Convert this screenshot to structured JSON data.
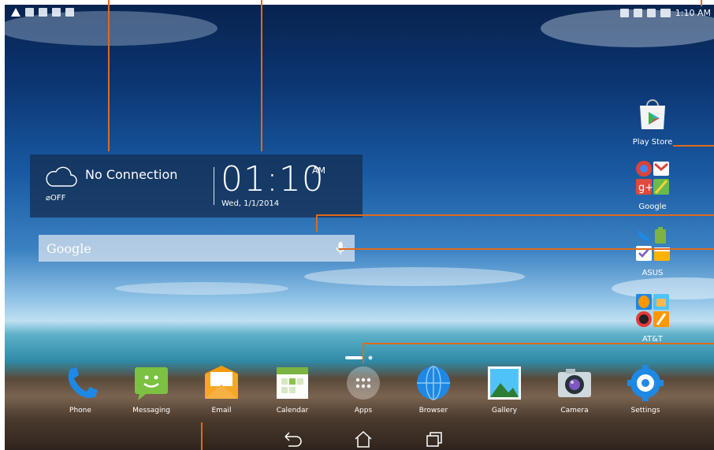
{
  "status_bar": {
    "time": "1:10 AM",
    "left_icons": [
      "alert-icon",
      "notification-icon",
      "email-icon",
      "sim-icon",
      "sd-card-icon"
    ],
    "right_icons": [
      "vibrate-icon",
      "no-signal-icon",
      "no-sim-icon",
      "battery-icon"
    ]
  },
  "weather_clock_widget": {
    "weather_status": "No Connection",
    "weather_toggle": "OFF",
    "time": "01:10",
    "ampm": "AM",
    "date": "Wed, 1/1/2014"
  },
  "search_bar": {
    "label": "Google"
  },
  "side_apps": [
    {
      "label": "Play Store",
      "icon": "play-store-icon"
    },
    {
      "label": "Google",
      "icon": "google-folder-icon"
    },
    {
      "label": "ASUS",
      "icon": "asus-folder-icon"
    },
    {
      "label": "AT&T",
      "icon": "att-folder-icon"
    }
  ],
  "dock": [
    {
      "label": "Phone",
      "icon": "phone-icon"
    },
    {
      "label": "Messaging",
      "icon": "messaging-icon"
    },
    {
      "label": "Email",
      "icon": "email-icon"
    },
    {
      "label": "Calendar",
      "icon": "calendar-icon"
    },
    {
      "label": "Apps",
      "icon": "apps-icon"
    },
    {
      "label": "Browser",
      "icon": "browser-icon"
    },
    {
      "label": "Gallery",
      "icon": "gallery-icon"
    },
    {
      "label": "Camera",
      "icon": "camera-icon"
    },
    {
      "label": "Settings",
      "icon": "settings-icon"
    }
  ],
  "page_indicator": {
    "pages": 2,
    "current": 1
  },
  "nav_bar": [
    "back-icon",
    "home-icon",
    "recent-apps-icon"
  ],
  "colors": {
    "callout": "#e06a1b"
  }
}
